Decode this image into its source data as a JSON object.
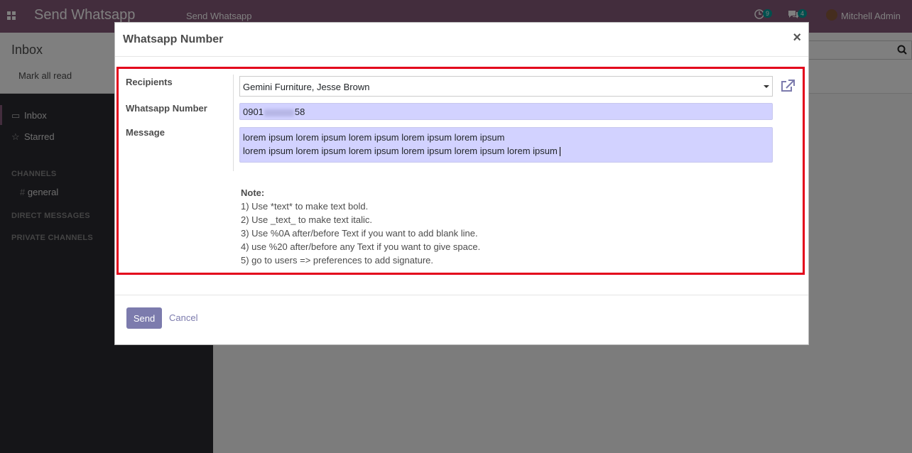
{
  "topbar": {
    "app_title": "Send Whatsapp",
    "menu_item": "Send Whatsapp",
    "activity_count": "9",
    "messages_count": "4",
    "user_name": "Mitchell Admin",
    "brand_color": "#875a7b"
  },
  "control_panel": {
    "title": "Inbox",
    "mark_all_read": "Mark all read"
  },
  "sidebar": {
    "items": [
      {
        "label": "Inbox",
        "icon": "inbox-icon"
      },
      {
        "label": "Starred",
        "icon": "star-icon"
      }
    ],
    "channels_header": "CHANNELS",
    "channels": [
      {
        "label": "general",
        "prefix": "#"
      }
    ],
    "direct_messages_header": "DIRECT MESSAGES",
    "private_channels_header": "PRIVATE CHANNELS"
  },
  "modal": {
    "title": "Whatsapp Number",
    "close": "×",
    "labels": {
      "recipients": "Recipients",
      "whatsapp_number": "Whatsapp Number",
      "message": "Message"
    },
    "recipients_value": "Gemini Furniture, Jesse Brown",
    "number_prefix": "0901",
    "number_suffix": "58",
    "message_line1": "lorem ipsum lorem ipsum lorem ipsum lorem ipsum lorem ipsum",
    "message_line2": "lorem ipsum lorem ipsum lorem ipsum lorem ipsum lorem ipsum lorem ipsum",
    "note_title": "Note:",
    "notes": [
      "1) Use *text* to make text bold.",
      "2) Use _text_ to make text italic.",
      "3) Use %0A after/before Text if you want to add blank line.",
      "4) use %20 after/before any Text if you want to give space.",
      "5) go to users => preferences to add signature."
    ],
    "send_label": "Send",
    "cancel_label": "Cancel",
    "highlight_color": "#e3001b",
    "input_bg_color": "#d2d2ff"
  }
}
